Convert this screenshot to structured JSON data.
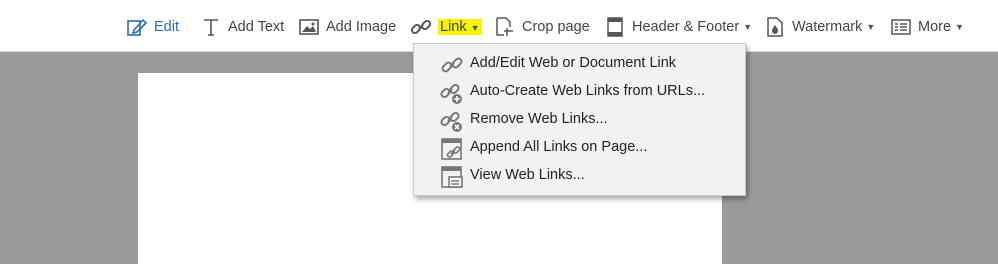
{
  "toolbar": {
    "edit": "Edit",
    "add_text": "Add Text",
    "add_image": "Add Image",
    "link": "Link",
    "crop_page": "Crop page",
    "header_footer": "Header & Footer",
    "watermark": "Watermark",
    "more": "More"
  },
  "link_menu": {
    "items": [
      {
        "label": "Add/Edit Web or Document Link",
        "icon": "link-icon"
      },
      {
        "label": "Auto-Create Web Links from URLs...",
        "icon": "link-add-icon"
      },
      {
        "label": "Remove Web Links...",
        "icon": "link-remove-icon"
      },
      {
        "label": "Append All Links on Page...",
        "icon": "page-link-icon"
      },
      {
        "label": "View Web Links...",
        "icon": "view-links-icon"
      }
    ]
  },
  "colors": {
    "accent": "#2a6db0",
    "highlight": "#f5f500",
    "workspace": "#9a9a9a"
  }
}
